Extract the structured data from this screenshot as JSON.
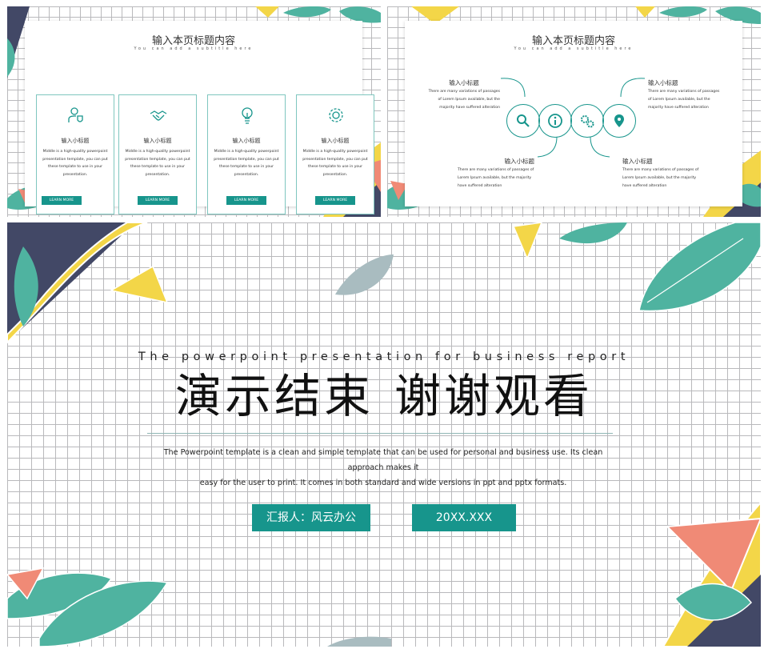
{
  "colors": {
    "accent": "#17958c",
    "navy": "#424866",
    "yellow": "#f3d648",
    "leaf": "#4fb3a0",
    "pink": "#f08a76",
    "grid": "#b9b9bc"
  },
  "slide1": {
    "title": "输入本页标题内容",
    "subtitle": "You can add a subtitle here",
    "cards": [
      {
        "icon": "user-shield-icon",
        "heading": "输入小标题",
        "body": "Middle is a high-quality powerpoint presentation template, you can put these template to use in your presentation.",
        "button": "LEARN MORE"
      },
      {
        "icon": "handshake-icon",
        "heading": "输入小标题",
        "body": "Middle is a high-quality powerpoint presentation template, you can put these template to use in your presentation.",
        "button": "LEARN MORE"
      },
      {
        "icon": "lightbulb-icon",
        "heading": "输入小标题",
        "body": "Middle is a high-quality powerpoint presentation template, you can put these template to use in your presentation.",
        "button": "LEARN MORE"
      },
      {
        "icon": "gear-icon",
        "heading": "输入小标题",
        "body": "Middle is a high-quality powerpoint presentation template, you can put these template to use in your presentation.",
        "button": "LEARN MORE"
      }
    ]
  },
  "slide2": {
    "title": "输入本页标题内容",
    "subtitle": "You can add a subtitle here",
    "items": [
      {
        "heading": "输入小标题",
        "body": "There are many variations of passages of Lorem Ipsum available, but the majority have suffered alteration"
      },
      {
        "heading": "输入小标题",
        "body": "There are many variations of passages of Lorem Ipsum available, but the majority have suffered alteration"
      },
      {
        "heading": "输入小标题",
        "body": "There are many variations of passages of Lorem Ipsum available, but the majority have suffered alteration"
      },
      {
        "heading": "输入小标题",
        "body": "There are many variations of passages of Lorem Ipsum available, but the majority have suffered alteration"
      }
    ],
    "circle_icons": [
      "search-icon",
      "info-icon",
      "gears-icon",
      "location-pin-icon"
    ]
  },
  "slide3": {
    "english_title": "The powerpoint presentation for business report",
    "chinese_title_left": "演示结束",
    "chinese_title_right": "谢谢观看",
    "description_line1": "The Powerpoint template is a clean and simple template that can be used for personal and business use. Its clean approach makes it",
    "description_line2": "easy for the user to print. It comes in both standard and wide versions in ppt and pptx formats.",
    "presenter": "汇报人：风云办公",
    "date": "20XX.XXX"
  }
}
